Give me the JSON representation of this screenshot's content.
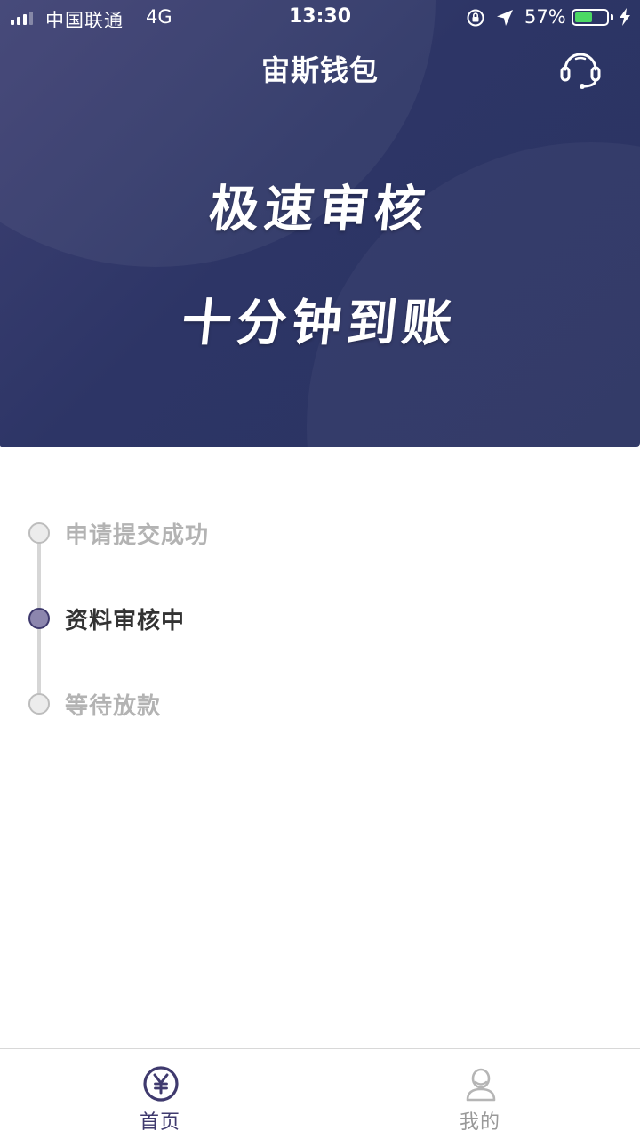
{
  "status_bar": {
    "carrier": "中国联通",
    "network": "4G",
    "time": "13:30",
    "battery_percent_label": "57%",
    "battery_level": 0.57
  },
  "header": {
    "title": "宙斯钱包",
    "service_icon": "headset-icon"
  },
  "hero": {
    "slogan_1": "极速审核",
    "slogan_2": "十分钟到账"
  },
  "timeline": {
    "steps": [
      {
        "label": "申请提交成功",
        "state": "done"
      },
      {
        "label": "资料审核中",
        "state": "active"
      },
      {
        "label": "等待放款",
        "state": "pending"
      }
    ]
  },
  "tab_bar": {
    "items": [
      {
        "label": "首页",
        "icon": "yuan-icon",
        "selected": true
      },
      {
        "label": "我的",
        "icon": "user-icon",
        "selected": false
      }
    ]
  },
  "colors": {
    "hero_bg": "#2d3566",
    "accent": "#3f3a6e",
    "battery": "#4cd964",
    "inactive_text": "#b3b3b3"
  }
}
